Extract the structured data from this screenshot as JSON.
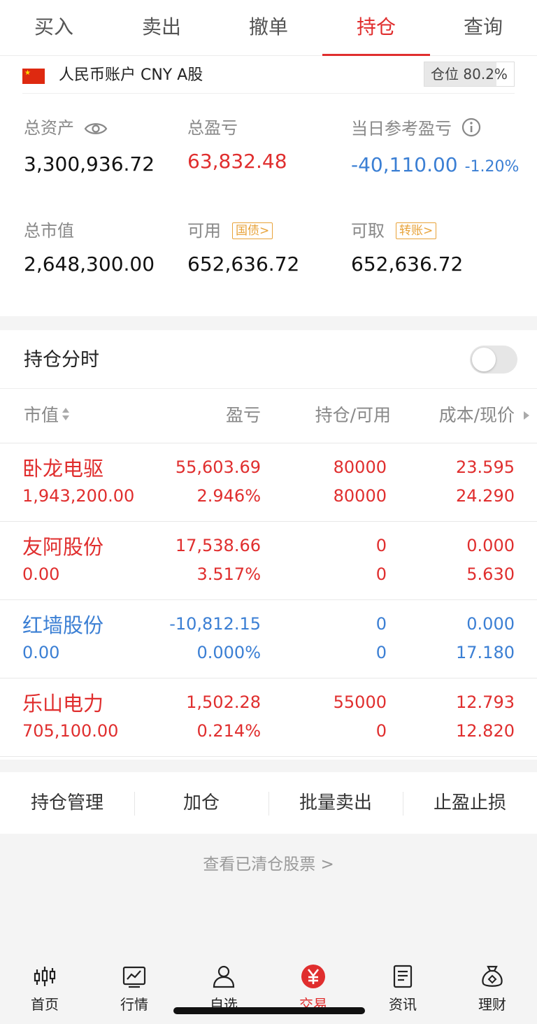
{
  "tabs": [
    {
      "label": "买入"
    },
    {
      "label": "卖出"
    },
    {
      "label": "撤单"
    },
    {
      "label": "持仓"
    },
    {
      "label": "查询"
    }
  ],
  "active_tab": "持仓",
  "account": {
    "name": "人民币账户 CNY A股",
    "position_label": "仓位 80.2%",
    "position_ratio": 0.802,
    "total_assets_label": "总资产",
    "total_assets": "3,300,936.72",
    "total_pnl_label": "总盈亏",
    "total_pnl": "63,832.48",
    "daily_pnl_label": "当日参考盈亏",
    "daily_pnl": "-40,110.00",
    "daily_pnl_pct": "-1.20%",
    "market_value_label": "总市值",
    "market_value": "2,648,300.00",
    "available_label": "可用",
    "available_tag": "国债>",
    "available": "652,636.72",
    "withdrawable_label": "可取",
    "withdrawable_tag": "转账>",
    "withdrawable": "652,636.72"
  },
  "holdings": {
    "intraday_label": "持仓分时",
    "intraday_enabled": false,
    "columns": [
      "市值",
      "盈亏",
      "持仓/可用",
      "成本/现价"
    ],
    "rows": [
      {
        "name": "卧龙电驱",
        "market_value": "1,943,200.00",
        "pnl": "55,603.69",
        "pnl_pct": "2.946%",
        "position": "80000",
        "available": "80000",
        "cost": "23.595",
        "price": "24.290",
        "color": "red"
      },
      {
        "name": "友阿股份",
        "market_value": "0.00",
        "pnl": "17,538.66",
        "pnl_pct": "3.517%",
        "position": "0",
        "available": "0",
        "cost": "0.000",
        "price": "5.630",
        "color": "red"
      },
      {
        "name": "红墙股份",
        "market_value": "0.00",
        "pnl": "-10,812.15",
        "pnl_pct": "0.000%",
        "position": "0",
        "available": "0",
        "cost": "0.000",
        "price": "17.180",
        "color": "blue"
      },
      {
        "name": "乐山电力",
        "market_value": "705,100.00",
        "pnl": "1,502.28",
        "pnl_pct": "0.214%",
        "position": "55000",
        "available": "0",
        "cost": "12.793",
        "price": "12.820",
        "color": "red"
      }
    ]
  },
  "actions": [
    {
      "label": "持仓管理"
    },
    {
      "label": "加仓"
    },
    {
      "label": "批量卖出"
    },
    {
      "label": "止盈止损"
    }
  ],
  "cleared_link": "查看已清仓股票 >",
  "bottom_nav": [
    {
      "label": "首页",
      "icon": "candlestick-icon"
    },
    {
      "label": "行情",
      "icon": "chart-icon"
    },
    {
      "label": "自选",
      "icon": "person-icon"
    },
    {
      "label": "交易",
      "icon": "yuan-icon"
    },
    {
      "label": "资讯",
      "icon": "news-icon"
    },
    {
      "label": "理财",
      "icon": "money-bag-icon"
    }
  ],
  "active_nav": "交易",
  "colors": {
    "up": "#e02e2e",
    "down": "#3b7fd4",
    "tag": "#e8a33a"
  }
}
